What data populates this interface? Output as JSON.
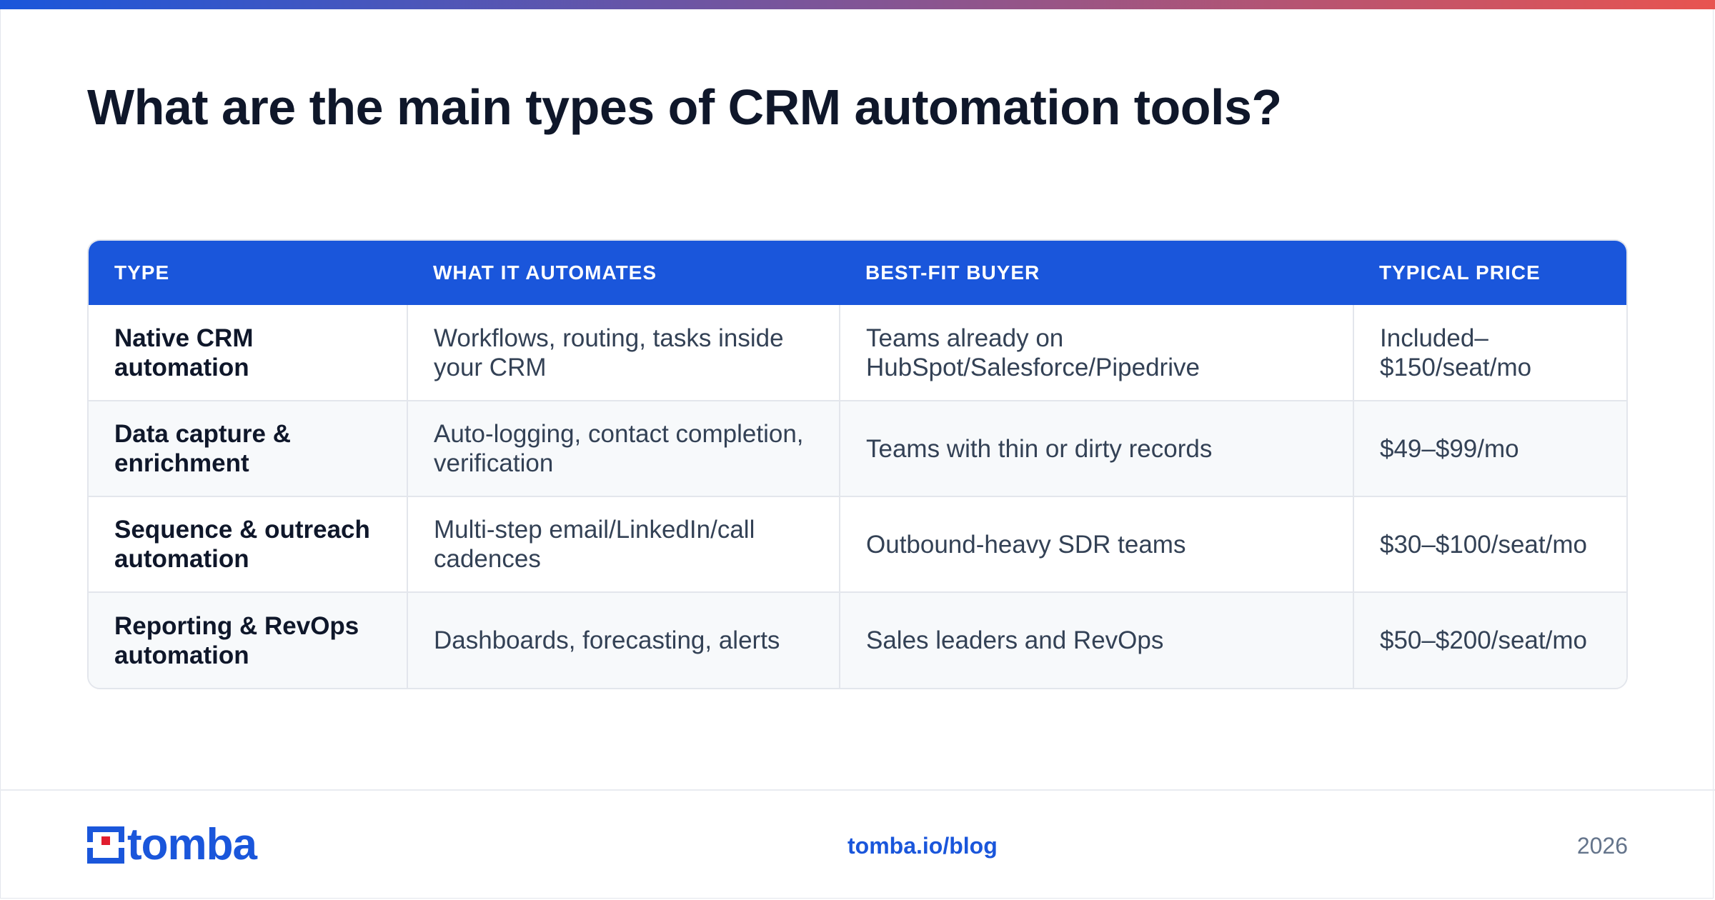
{
  "colors": {
    "accent": "#1a56db",
    "gradient_start": "#1a56db",
    "gradient_end": "#e85450",
    "title": "#0f172a",
    "body_text": "#334155",
    "muted": "#64748b"
  },
  "title": "What are the main types of CRM automation tools?",
  "table": {
    "headers": [
      "TYPE",
      "WHAT IT AUTOMATES",
      "BEST-FIT BUYER",
      "TYPICAL PRICE"
    ],
    "rows": [
      [
        "Native CRM automation",
        "Workflows, routing, tasks inside your CRM",
        "Teams already on HubSpot/Salesforce/Pipedrive",
        "Included–$150/seat/mo"
      ],
      [
        "Data capture & enrichment",
        "Auto-logging, contact completion, verification",
        "Teams with thin or dirty records",
        "$49–$99/mo"
      ],
      [
        "Sequence & outreach automation",
        "Multi-step email/LinkedIn/call cadences",
        "Outbound-heavy SDR teams",
        "$30–$100/seat/mo"
      ],
      [
        "Reporting & RevOps automation",
        "Dashboards, forecasting, alerts",
        "Sales leaders and RevOps",
        "$50–$200/seat/mo"
      ]
    ]
  },
  "footer": {
    "logo_text": "tomba",
    "logo_icon": "tomba-logo-icon",
    "link": "tomba.io/blog",
    "year": "2026"
  }
}
